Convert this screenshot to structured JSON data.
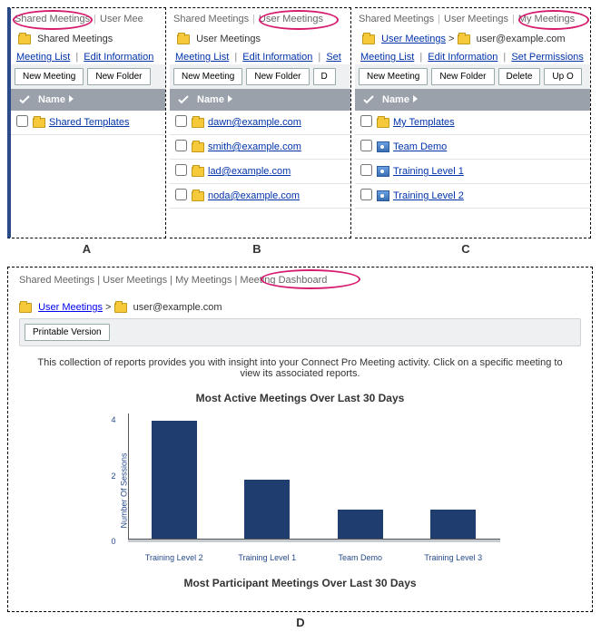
{
  "tabs": {
    "shared": "Shared Meetings",
    "user": "User Meetings",
    "my": "My Meetings",
    "dashboard": "Meeting Dashboard",
    "userTrunc": "User Mee",
    "userTruncC": "User Meetings"
  },
  "panelA": {
    "breadcrumb": "Shared Meetings",
    "actions": {
      "list": "Meeting List",
      "edit": "Edit Information"
    },
    "buttons": {
      "newMeeting": "New Meeting",
      "newFolder": "New Folder"
    },
    "nameHeader": "Name",
    "rows": [
      {
        "type": "folder",
        "label": "Shared Templates"
      }
    ]
  },
  "panelB": {
    "breadcrumb": "User Meetings",
    "actions": {
      "list": "Meeting List",
      "edit": "Edit Information",
      "set": "Set"
    },
    "buttons": {
      "newMeeting": "New Meeting",
      "newFolder": "New Folder",
      "delete": "D"
    },
    "nameHeader": "Name",
    "rows": [
      {
        "type": "folder",
        "label": "dawn@example.com"
      },
      {
        "type": "folder",
        "label": "smith@example.com"
      },
      {
        "type": "folder",
        "label": "lad@example.com"
      },
      {
        "type": "folder",
        "label": "noda@example.com"
      }
    ]
  },
  "panelC": {
    "breadcrumb1": "User Meetings",
    "breadcrumb2": "user@example.com",
    "actions": {
      "list": "Meeting List",
      "edit": "Edit Information",
      "set": "Set Permissions"
    },
    "buttons": {
      "newMeeting": "New Meeting",
      "newFolder": "New Folder",
      "delete": "Delete",
      "up": "Up O"
    },
    "nameHeader": "Name",
    "rows": [
      {
        "type": "folder",
        "label": "My Templates"
      },
      {
        "type": "meeting",
        "label": "Team Demo"
      },
      {
        "type": "meeting",
        "label": "Training Level 1"
      },
      {
        "type": "meeting",
        "label": "Training Level 2"
      }
    ]
  },
  "panelD": {
    "breadcrumb1": "User Meetings",
    "breadcrumb2": "user@example.com",
    "printable": "Printable Version",
    "description": "This collection of reports provides you with insight into your Connect Pro Meeting activity. Click on a specific meeting to view its associated reports.",
    "chart1Title": "Most Active Meetings Over Last 30 Days",
    "chart2Title": "Most Participant Meetings Over Last 30 Days",
    "ylabel": "Number Of Sessions"
  },
  "labels": {
    "A": "A",
    "B": "B",
    "C": "C",
    "D": "D",
    "gt": ">"
  },
  "colors": {
    "bar": "#1f3d6e",
    "circle": "#d61a6d"
  },
  "chart_data": {
    "type": "bar",
    "title": "Most Active Meetings Over Last 30 Days",
    "ylabel": "Number Of Sessions",
    "ylim": [
      0,
      4
    ],
    "yticks": [
      0,
      2,
      4
    ],
    "categories": [
      "Training Level 2",
      "Training Level 1",
      "Team Demo",
      "Training Level 3"
    ],
    "values": [
      4,
      2,
      1,
      1
    ]
  }
}
